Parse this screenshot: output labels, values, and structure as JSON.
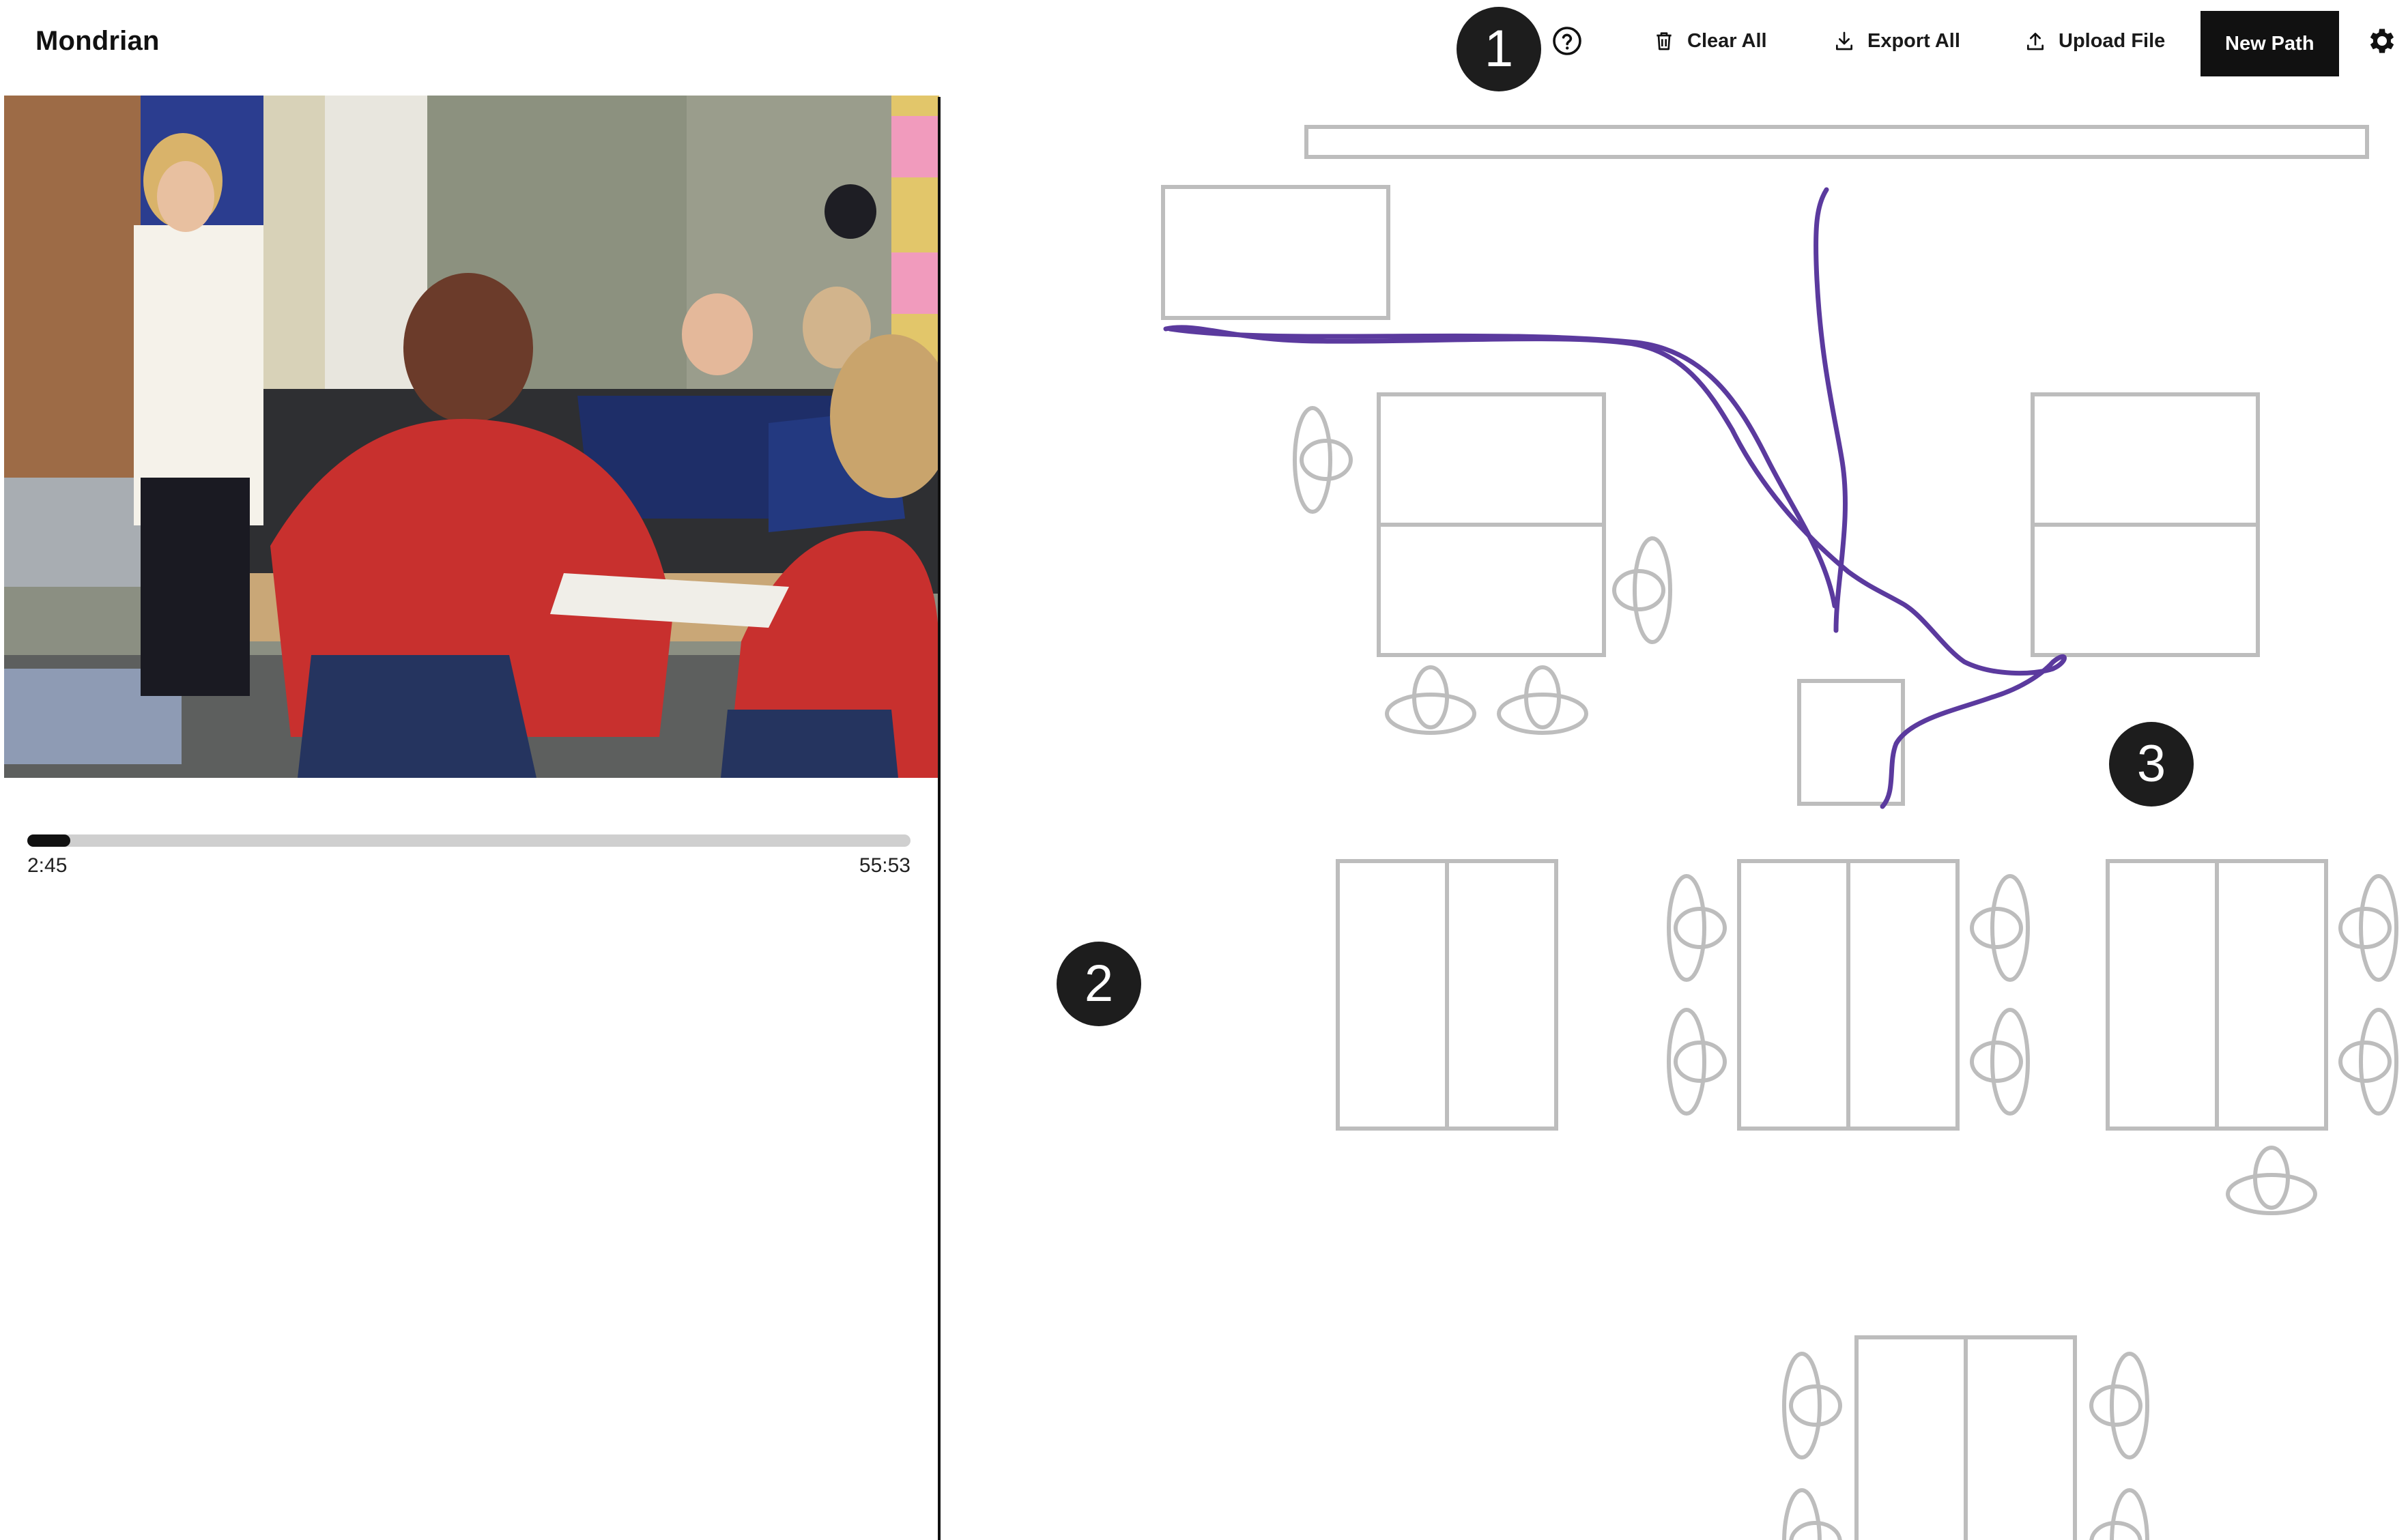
{
  "app": {
    "title": "Mondrian"
  },
  "toolbar": {
    "help_icon": "question-circle-icon",
    "clear_label": "Clear All",
    "clear_icon": "trash-icon",
    "export_label": "Export All",
    "export_icon": "download-icon",
    "upload_label": "Upload File",
    "upload_icon": "upload-icon",
    "new_path_label": "New Path",
    "settings_icon": "gear-icon"
  },
  "markers": [
    "1",
    "2",
    "3"
  ],
  "video": {
    "current_time": "2:45",
    "total_time": "55:53",
    "progress": 0.049
  },
  "canvas": {
    "path_color": "#5b3a9e",
    "layout_color": "#bdbdbd"
  }
}
